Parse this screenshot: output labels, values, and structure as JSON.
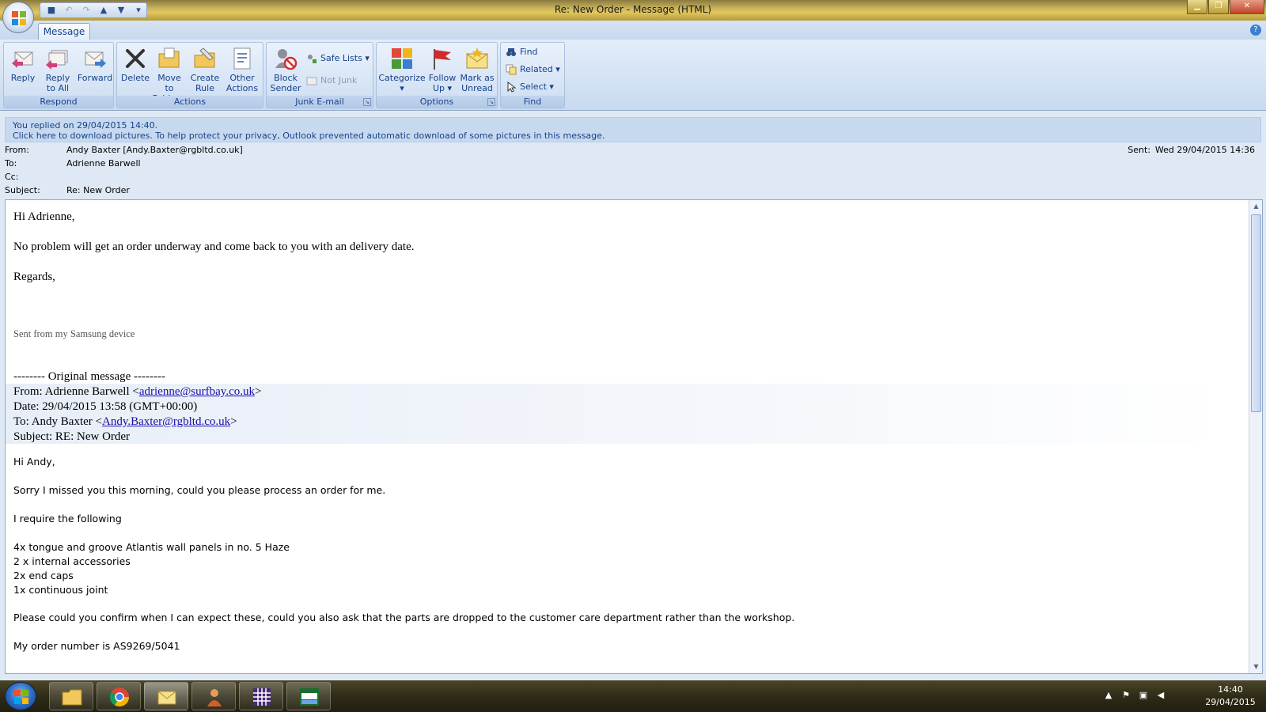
{
  "window": {
    "title": "Re: New Order - Message (HTML)"
  },
  "ribbon": {
    "tab": "Message",
    "groups": {
      "respond": {
        "label": "Respond",
        "reply": "Reply",
        "reply_all": "Reply\nto All",
        "forward": "Forward"
      },
      "actions": {
        "label": "Actions",
        "delete": "Delete",
        "move": "Move to\nFolder ▾",
        "create_rule": "Create\nRule",
        "other": "Other\nActions ▾"
      },
      "junk": {
        "label": "Junk E-mail",
        "block": "Block\nSender",
        "safe_lists": "Safe Lists ▾",
        "not_junk": "Not Junk"
      },
      "options": {
        "label": "Options",
        "categorize": "Categorize\n▾",
        "follow_up": "Follow\nUp ▾",
        "mark_unread": "Mark as\nUnread"
      },
      "find": {
        "label": "Find",
        "find": "Find",
        "related": "Related ▾",
        "select": "Select ▾"
      }
    }
  },
  "infobar": {
    "line1": "You replied on 29/04/2015 14:40.",
    "line2": "Click here to download pictures. To help protect your privacy, Outlook prevented automatic download of some pictures in this message."
  },
  "headers": {
    "from_label": "From:",
    "from": "Andy Baxter [Andy.Baxter@rgbltd.co.uk]",
    "to_label": "To:",
    "to": "Adrienne Barwell",
    "cc_label": "Cc:",
    "cc": "",
    "subject_label": "Subject:",
    "subject": "Re: New Order",
    "sent_label": "Sent:",
    "sent": "Wed 29/04/2015 14:36"
  },
  "body": {
    "greeting": "Hi Adrienne,",
    "line1": "No problem will get an order underway and come back to you with an delivery date.",
    "regards": "Regards,",
    "signature": "Sent from my Samsung device",
    "original_sep": "-------- Original message --------",
    "q_from_prefix": "From: Adrienne Barwell <",
    "q_from_email": "adrienne@surfbay.co.uk",
    "q_from_suffix": ">",
    "q_date": "Date: 29/04/2015 13:58 (GMT+00:00)",
    "q_to_prefix": "To: Andy Baxter <",
    "q_to_email": "Andy.Baxter@rgbltd.co.uk",
    "q_to_suffix": ">",
    "q_subject": "Subject: RE: New Order",
    "q_greeting": "Hi Andy,",
    "q_line1": "Sorry I missed you this morning, could you please process an order for me.",
    "q_line2": "I require the following",
    "items": [
      "4x tongue and groove Atlantis wall panels in no. 5 Haze",
      "2 x internal accessories",
      "2x end caps",
      "1x continuous joint"
    ],
    "q_line3": "Please could you confirm when I can expect these, could you also ask that the parts are dropped to the customer care department rather than the workshop.",
    "q_line4": "My order number is AS9269/5041"
  },
  "taskbar": {
    "apps": [
      "file-explorer",
      "chrome",
      "outlook",
      "contacts",
      "calculator",
      "sage"
    ],
    "time": "14:40",
    "date": "29/04/2015"
  }
}
